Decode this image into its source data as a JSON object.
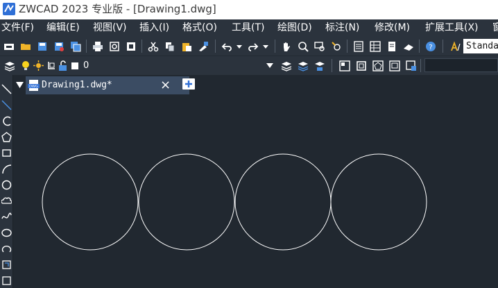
{
  "titlebar": {
    "title": "ZWCAD 2023 专业版 - [Drawing1.dwg]"
  },
  "menubar": {
    "items": [
      "文件(F)",
      "编辑(E)",
      "视图(V)",
      "插入(I)",
      "格式(O)",
      "工具(T)",
      "绘图(D)",
      "标注(N)",
      "修改(M)",
      "扩展工具(X)",
      "窗"
    ]
  },
  "toolbar": {
    "text_style": "Standa"
  },
  "layer_toolbar": {
    "current_layer": "0"
  },
  "document_tabs": {
    "active_tab": "Drawing1.dwg*",
    "close_symbol": "×"
  },
  "drawing": {
    "entities": [
      {
        "type": "circle",
        "index": 1
      },
      {
        "type": "circle",
        "index": 2
      },
      {
        "type": "circle",
        "index": 3
      },
      {
        "type": "circle",
        "index": 4
      }
    ],
    "stroke_color": "#ffffff",
    "background_color": "#212830"
  },
  "colors": {
    "ui_panel": "#2b333d",
    "active_tab": "#3b4c63",
    "accent_icon": "#4a90e2"
  }
}
